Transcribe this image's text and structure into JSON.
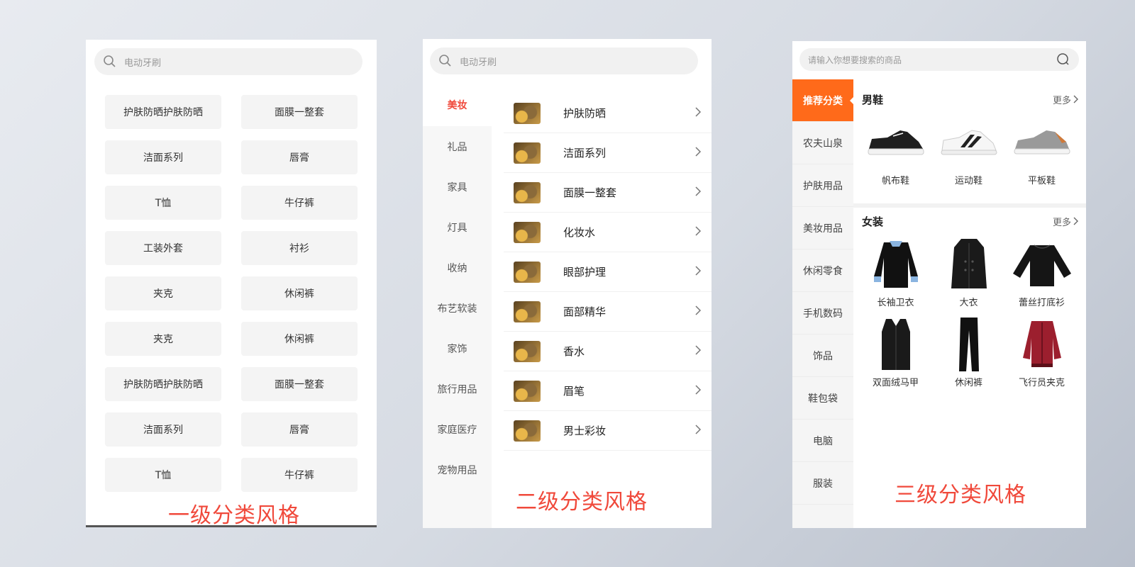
{
  "panel1": {
    "search_placeholder": "电动牙刷",
    "chips": [
      "护肤防晒护肤防晒",
      "面膜一整套",
      "洁面系列",
      "唇膏",
      "T恤",
      "牛仔裤",
      "工装外套",
      "衬衫",
      "夹克",
      "休闲裤",
      "夹克",
      "休闲裤",
      "护肤防晒护肤防晒",
      "面膜一整套",
      "洁面系列",
      "唇膏",
      "T恤",
      "牛仔裤"
    ],
    "caption": "一级分类风格"
  },
  "panel2": {
    "search_placeholder": "电动牙刷",
    "sidebar": [
      "美妆",
      "礼品",
      "家具",
      "灯具",
      "收纳",
      "布艺软装",
      "家饰",
      "旅行用品",
      "家庭医疗",
      "宠物用品"
    ],
    "items": [
      "护肤防晒",
      "洁面系列",
      "面膜一整套",
      "化妆水",
      "眼部护理",
      "面部精华",
      "香水",
      "眉笔",
      "男士彩妆"
    ],
    "caption": "二级分类风格"
  },
  "panel3": {
    "search_placeholder": "请输入你想要搜索的商品",
    "sidebar": [
      "推荐分类",
      "农夫山泉",
      "护肤用品",
      "美妆用品",
      "休闲零食",
      "手机数码",
      "饰品",
      "鞋包袋",
      "电脑",
      "服装"
    ],
    "sections": [
      {
        "title": "男鞋",
        "more": "更多",
        "products": [
          "帆布鞋",
          "运动鞋",
          "平板鞋"
        ]
      },
      {
        "title": "女装",
        "more": "更多",
        "products": [
          "长袖卫衣",
          "大衣",
          "蕾丝打底衫",
          "双面绒马甲",
          "休闲裤",
          "飞行员夹克"
        ]
      }
    ],
    "caption": "三级分类风格"
  },
  "colors": {
    "accent_red": "#f0493b",
    "accent_orange": "#ff6a1a"
  }
}
